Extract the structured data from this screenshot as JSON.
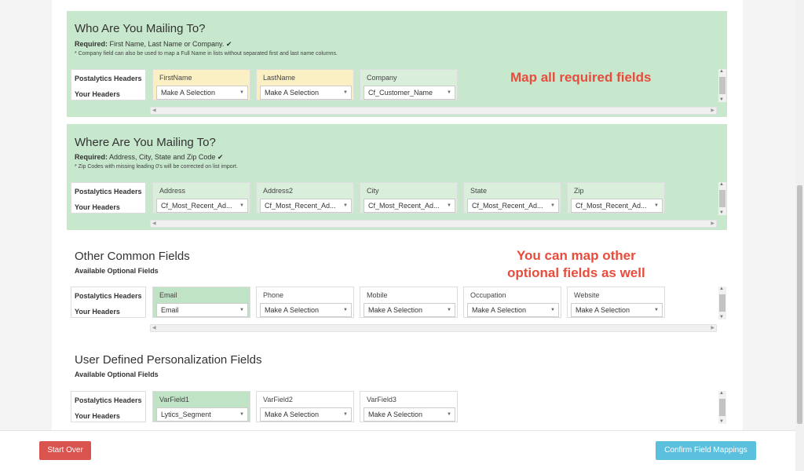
{
  "sections": [
    {
      "title": "Who Are You Mailing To?",
      "required_label": "Required:",
      "required_text": " First Name, Last Name or Company. ✔",
      "note": "* Company field can also be used to map a Full Name in lists without separated first and last name columns.",
      "header_rows": [
        "Postalytics Headers",
        "Your Headers"
      ],
      "columns": [
        {
          "label": "FirstName",
          "value": "Make A Selection"
        },
        {
          "label": "LastName",
          "value": "Make A Selection"
        },
        {
          "label": "Company",
          "value": "Cf_Customer_Name"
        }
      ]
    },
    {
      "title": "Where Are You Mailing To?",
      "required_label": "Required:",
      "required_text": " Address, City, State and Zip Code ✔",
      "note": "* Zip Codes with missing leading 0's will be corrected on list import.",
      "header_rows": [
        "Postalytics Headers",
        "Your Headers"
      ],
      "columns": [
        {
          "label": "Address",
          "value": "Cf_Most_Recent_Ad..."
        },
        {
          "label": "Address2",
          "value": "Cf_Most_Recent_Ad..."
        },
        {
          "label": "City",
          "value": "Cf_Most_Recent_Ad..."
        },
        {
          "label": "State",
          "value": "Cf_Most_Recent_Ad..."
        },
        {
          "label": "Zip",
          "value": "Cf_Most_Recent_Ad..."
        }
      ]
    },
    {
      "title": "Other Common Fields",
      "subtitle": "Available Optional Fields",
      "header_rows": [
        "Postalytics Headers",
        "Your Headers"
      ],
      "columns": [
        {
          "label": "Email",
          "value": "Email"
        },
        {
          "label": "Phone",
          "value": "Make A Selection"
        },
        {
          "label": "Mobile",
          "value": "Make A Selection"
        },
        {
          "label": "Occupation",
          "value": "Make A Selection"
        },
        {
          "label": "Website",
          "value": "Make A Selection"
        }
      ]
    },
    {
      "title": "User Defined Personalization Fields",
      "subtitle": "Available Optional Fields",
      "header_rows": [
        "Postalytics Headers",
        "Your Headers"
      ],
      "columns": [
        {
          "label": "VarField1",
          "value": "Lytics_Segment"
        },
        {
          "label": "VarField2",
          "value": "Make A Selection"
        },
        {
          "label": "VarField3",
          "value": "Make A Selection"
        }
      ]
    }
  ],
  "annotations": {
    "a1": "Map all required fields",
    "a2_line1": "You can map other",
    "a2_line2": "optional fields as well"
  },
  "footer": {
    "start_over": "Start Over",
    "confirm": "Confirm Field Mappings"
  },
  "icons": {
    "caret": "▼",
    "arrow_left": "◀",
    "arrow_right": "▶",
    "arrow_up": "▲",
    "arrow_down": "▼"
  },
  "colors": {
    "section_green": "#c7e8cc",
    "highlight_yellow": "#fbefc4",
    "mapped_green": "#bfe3c4",
    "annotation_red": "#e74c3c",
    "start_over_red": "#d9534f",
    "confirm_blue": "#5bc0de"
  }
}
